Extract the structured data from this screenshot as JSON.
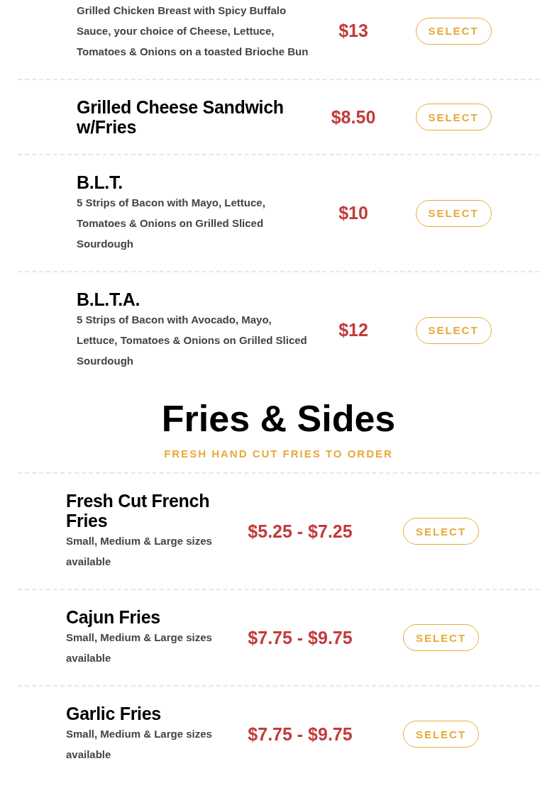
{
  "sections": [
    {
      "kind": "wide",
      "items": [
        {
          "description": "Grilled Chicken Breast with Spicy Buffalo Sauce, your choice of Cheese, Lettuce, Tomatoes & Onions on a toasted Brioche Bun",
          "price": "$13",
          "button": "SELECT"
        },
        {
          "title": "Grilled Cheese Sandwich w/Fries",
          "price": "$8.50",
          "button": "SELECT"
        },
        {
          "title": "B.L.T.",
          "description": "5 Strips of Bacon with Mayo, Lettuce, Tomatoes & Onions on Grilled Sliced Sourdough",
          "price": "$10",
          "button": "SELECT"
        },
        {
          "title": "B.L.T.A.",
          "description": "5 Strips of Bacon with Avocado, Mayo, Lettuce, Tomatoes & Onions on Grilled Sliced Sourdough",
          "price": "$12",
          "button": "SELECT"
        }
      ]
    },
    {
      "kind": "narrow",
      "heading": "Fries & Sides",
      "subheading": "FRESH HAND CUT FRIES TO ORDER",
      "items": [
        {
          "title": "Fresh Cut French Fries",
          "description": "Small, Medium & Large sizes available",
          "price": "$5.25 - $7.25",
          "button": "SELECT"
        },
        {
          "title": "Cajun Fries",
          "description": "Small, Medium & Large sizes available",
          "price": "$7.75 - $9.75",
          "button": "SELECT"
        },
        {
          "title": "Garlic Fries",
          "description": "Small, Medium & Large sizes available",
          "price": "$7.75 - $9.75",
          "button": "SELECT"
        }
      ]
    }
  ]
}
